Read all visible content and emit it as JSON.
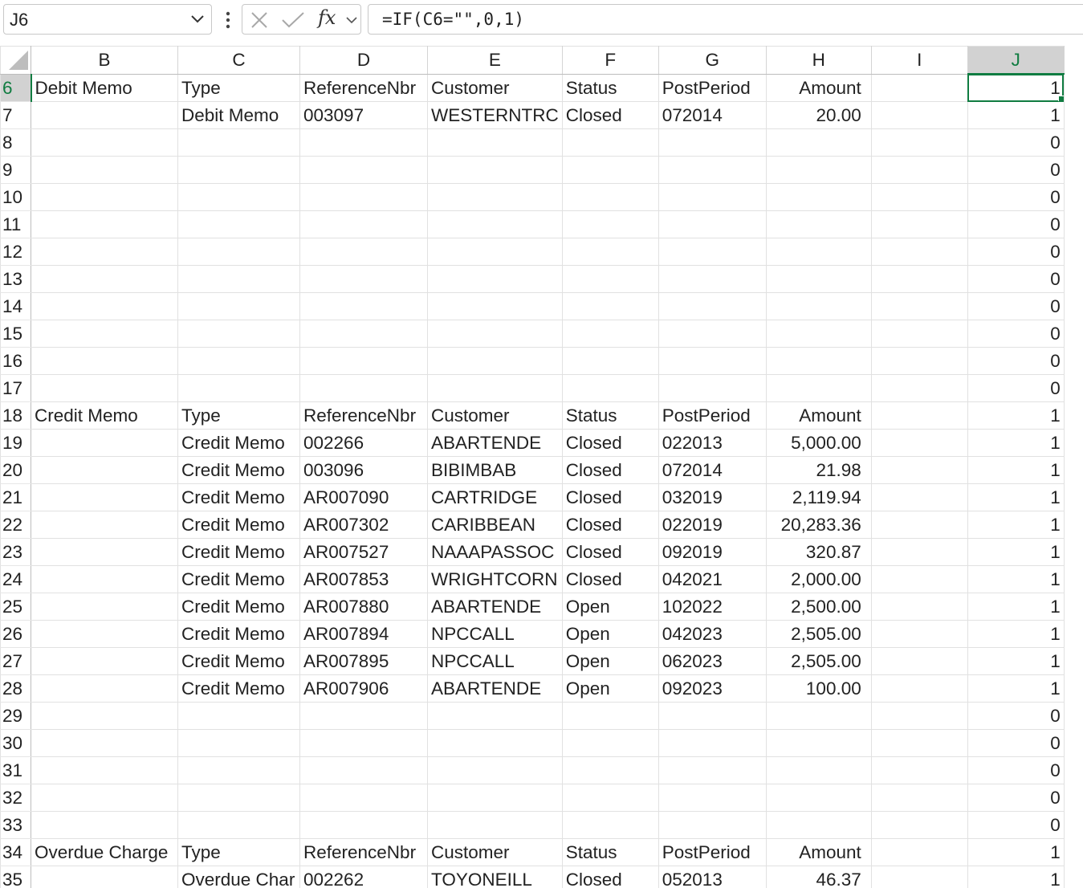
{
  "formula_bar": {
    "name_box": "J6",
    "formula": "=IF(C6=\"\",0,1)",
    "fx_label": "fx"
  },
  "colors": {
    "accent": "#107c41",
    "gridline": "#e1e1e1",
    "header_active_bg": "#d2d2d2"
  },
  "columns": [
    "B",
    "C",
    "D",
    "E",
    "F",
    "G",
    "H",
    "I",
    "J"
  ],
  "active_cell": "J6",
  "rows": [
    {
      "n": "6",
      "B": "Debit Memo",
      "C": "Type",
      "D": "ReferenceNbr",
      "E": "Customer",
      "F": "Status",
      "G": "PostPeriod",
      "H": "Amount",
      "J": "1"
    },
    {
      "n": "7",
      "B": "",
      "C": "Debit Memo",
      "D": "003097",
      "E": "WESTERNTRC",
      "F": "Closed",
      "G": "072014",
      "H": "20.00",
      "J": "1"
    },
    {
      "n": "8",
      "B": "",
      "C": "",
      "D": "",
      "E": "",
      "F": "",
      "G": "",
      "H": "",
      "J": "0"
    },
    {
      "n": "9",
      "B": "",
      "C": "",
      "D": "",
      "E": "",
      "F": "",
      "G": "",
      "H": "",
      "J": "0"
    },
    {
      "n": "10",
      "B": "",
      "C": "",
      "D": "",
      "E": "",
      "F": "",
      "G": "",
      "H": "",
      "J": "0"
    },
    {
      "n": "11",
      "B": "",
      "C": "",
      "D": "",
      "E": "",
      "F": "",
      "G": "",
      "H": "",
      "J": "0"
    },
    {
      "n": "12",
      "B": "",
      "C": "",
      "D": "",
      "E": "",
      "F": "",
      "G": "",
      "H": "",
      "J": "0"
    },
    {
      "n": "13",
      "B": "",
      "C": "",
      "D": "",
      "E": "",
      "F": "",
      "G": "",
      "H": "",
      "J": "0"
    },
    {
      "n": "14",
      "B": "",
      "C": "",
      "D": "",
      "E": "",
      "F": "",
      "G": "",
      "H": "",
      "J": "0"
    },
    {
      "n": "15",
      "B": "",
      "C": "",
      "D": "",
      "E": "",
      "F": "",
      "G": "",
      "H": "",
      "J": "0"
    },
    {
      "n": "16",
      "B": "",
      "C": "",
      "D": "",
      "E": "",
      "F": "",
      "G": "",
      "H": "",
      "J": "0"
    },
    {
      "n": "17",
      "B": "",
      "C": "",
      "D": "",
      "E": "",
      "F": "",
      "G": "",
      "H": "",
      "J": "0"
    },
    {
      "n": "18",
      "B": "Credit Memo",
      "C": "Type",
      "D": "ReferenceNbr",
      "E": "Customer",
      "F": "Status",
      "G": "PostPeriod",
      "H": "Amount",
      "J": "1"
    },
    {
      "n": "19",
      "B": "",
      "C": "Credit Memo",
      "D": "002266",
      "E": "ABARTENDE",
      "F": "Closed",
      "G": "022013",
      "H": "5,000.00",
      "J": "1"
    },
    {
      "n": "20",
      "B": "",
      "C": "Credit Memo",
      "D": "003096",
      "E": "BIBIMBAB",
      "F": "Closed",
      "G": "072014",
      "H": "21.98",
      "J": "1"
    },
    {
      "n": "21",
      "B": "",
      "C": "Credit Memo",
      "D": "AR007090",
      "E": "CARTRIDGE",
      "F": "Closed",
      "G": "032019",
      "H": "2,119.94",
      "J": "1"
    },
    {
      "n": "22",
      "B": "",
      "C": "Credit Memo",
      "D": "AR007302",
      "E": "CARIBBEAN",
      "F": "Closed",
      "G": "022019",
      "H": "20,283.36",
      "J": "1"
    },
    {
      "n": "23",
      "B": "",
      "C": "Credit Memo",
      "D": "AR007527",
      "E": "NAAAPASSOC",
      "F": "Closed",
      "G": "092019",
      "H": "320.87",
      "J": "1"
    },
    {
      "n": "24",
      "B": "",
      "C": "Credit Memo",
      "D": "AR007853",
      "E": "WRIGHTCORN",
      "F": "Closed",
      "G": "042021",
      "H": "2,000.00",
      "J": "1"
    },
    {
      "n": "25",
      "B": "",
      "C": "Credit Memo",
      "D": "AR007880",
      "E": "ABARTENDE",
      "F": "Open",
      "G": "102022",
      "H": "2,500.00",
      "J": "1"
    },
    {
      "n": "26",
      "B": "",
      "C": "Credit Memo",
      "D": "AR007894",
      "E": "NPCCALL",
      "F": "Open",
      "G": "042023",
      "H": "2,505.00",
      "J": "1"
    },
    {
      "n": "27",
      "B": "",
      "C": "Credit Memo",
      "D": "AR007895",
      "E": "NPCCALL",
      "F": "Open",
      "G": "062023",
      "H": "2,505.00",
      "J": "1"
    },
    {
      "n": "28",
      "B": "",
      "C": "Credit Memo",
      "D": "AR007906",
      "E": "ABARTENDE",
      "F": "Open",
      "G": "092023",
      "H": "100.00",
      "J": "1"
    },
    {
      "n": "29",
      "B": "",
      "C": "",
      "D": "",
      "E": "",
      "F": "",
      "G": "",
      "H": "",
      "J": "0"
    },
    {
      "n": "30",
      "B": "",
      "C": "",
      "D": "",
      "E": "",
      "F": "",
      "G": "",
      "H": "",
      "J": "0"
    },
    {
      "n": "31",
      "B": "",
      "C": "",
      "D": "",
      "E": "",
      "F": "",
      "G": "",
      "H": "",
      "J": "0"
    },
    {
      "n": "32",
      "B": "",
      "C": "",
      "D": "",
      "E": "",
      "F": "",
      "G": "",
      "H": "",
      "J": "0"
    },
    {
      "n": "33",
      "B": "",
      "C": "",
      "D": "",
      "E": "",
      "F": "",
      "G": "",
      "H": "",
      "J": "0"
    },
    {
      "n": "34",
      "B": "Overdue Charge",
      "C": "Type",
      "D": "ReferenceNbr",
      "E": "Customer",
      "F": "Status",
      "G": "PostPeriod",
      "H": "Amount",
      "J": "1"
    },
    {
      "n": "35",
      "B": "",
      "C": "Overdue Char",
      "D": "002262",
      "E": "TOYONEILL",
      "F": "Closed",
      "G": "052013",
      "H": "46.37",
      "J": "1"
    }
  ]
}
